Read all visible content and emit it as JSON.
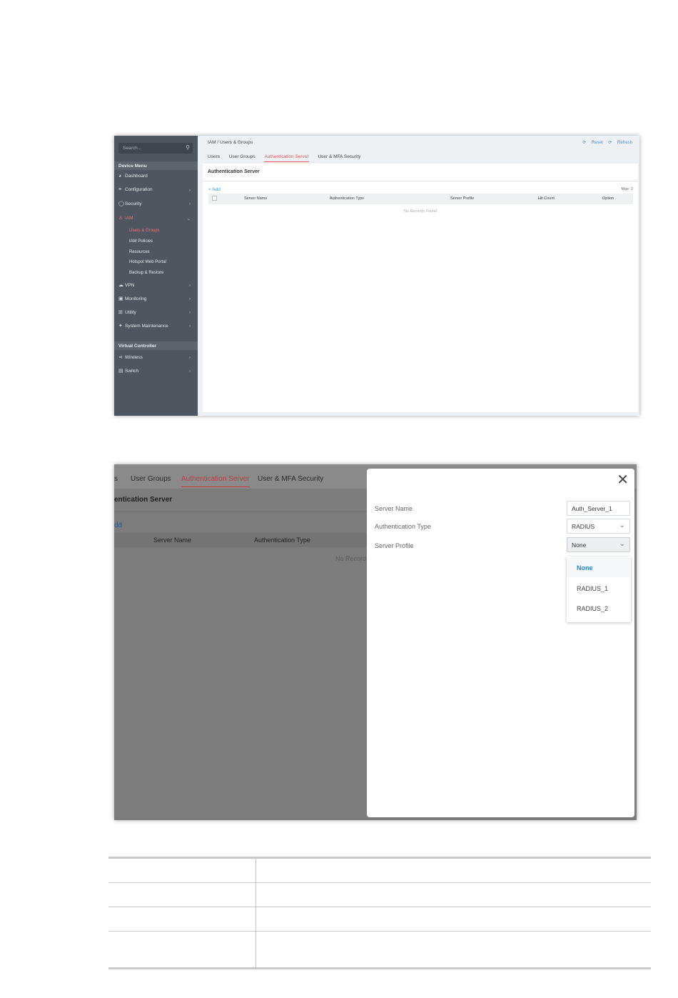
{
  "screenshot1": {
    "sidebar": {
      "search_placeholder": "Search...",
      "section_device": "Device Menu",
      "section_virtual": "Virtual Controller",
      "items": [
        {
          "label": "Dashboard",
          "icon": "dashboard-icon"
        },
        {
          "label": "Configuration",
          "icon": "sliders-icon"
        },
        {
          "label": "Security",
          "icon": "shield-icon"
        },
        {
          "label": "IAM",
          "icon": "user-lock-icon"
        },
        {
          "label": "VPN",
          "icon": "cloud-lock-icon"
        },
        {
          "label": "Monitoring",
          "icon": "monitor-icon"
        },
        {
          "label": "Utility",
          "icon": "grid-icon"
        },
        {
          "label": "System Maintenance",
          "icon": "wrench-icon"
        },
        {
          "label": "Wireless",
          "icon": "wireless-icon"
        },
        {
          "label": "Switch",
          "icon": "switch-icon"
        }
      ],
      "iam_sub": [
        "Users & Groups",
        "IAM Policies",
        "Resources",
        "Hotspot Web Portal",
        "Backup & Restore"
      ]
    },
    "breadcrumb": "IAM / Users & Groups",
    "reset_label": "Reset",
    "refresh_label": "Refresh",
    "tabs": [
      "Users",
      "User Groups",
      "Authentication Server",
      "User & MFA Security"
    ],
    "panel_title": "Authentication Server",
    "add_label": "+ Add",
    "max_label": "Max: 2",
    "columns": [
      "Server Name",
      "Authentication Type",
      "Server Profile",
      "Hit Count",
      "Option"
    ],
    "empty_text": "No Records Found"
  },
  "screenshot2": {
    "tabs": [
      "s",
      "User Groups",
      "Authentication Server",
      "User & MFA Security"
    ],
    "title": "entication Server",
    "add_label": "dd",
    "columns": [
      "Server Name",
      "Authentication Type"
    ],
    "empty_text": "No Record",
    "dialog": {
      "close_glyph": "✕",
      "server_name_label": "Server Name",
      "server_name_value": "Auth_Server_1",
      "auth_type_label": "Authentication Type",
      "auth_type_value": "RADIUS",
      "server_profile_label": "Server Profile",
      "server_profile_value": "None",
      "profile_options": [
        "None",
        "RADIUS_1",
        "RADIUS_2"
      ]
    }
  },
  "colors": {
    "accent_red": "#e4545d",
    "link_blue": "#4a90d9",
    "sidebar_bg": "#4f5660",
    "selected_option": "#1e88d8"
  }
}
